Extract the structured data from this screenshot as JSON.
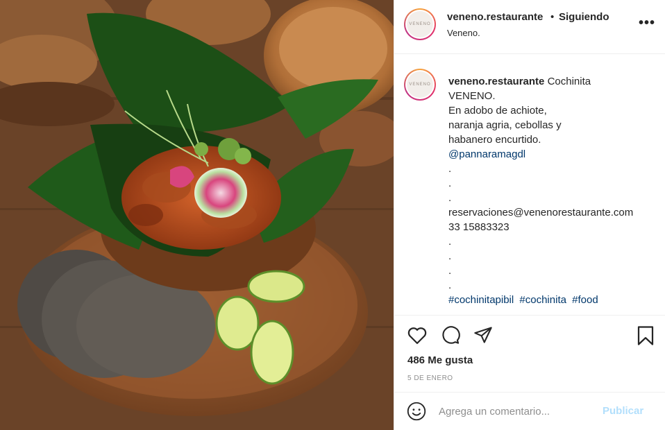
{
  "post": {
    "username": "veneno.restaurante",
    "separator": "•",
    "follow_status": "Siguiendo",
    "location": "Veneno.",
    "more_label": "•••",
    "avatar_text": "VENENO"
  },
  "caption": {
    "username": "veneno.restaurante",
    "lines": [
      "Cochinita",
      "VENENO.",
      "En adobo de achiote,",
      "naranja agria, cebollas y",
      "habanero encurtido.",
      "@pannaramagdl",
      ".",
      ".",
      ".",
      "reservaciones@venenorestaurante.com",
      "33 15883323",
      ".",
      ".",
      ".",
      "."
    ],
    "hashtags": [
      "#cochinitapibil",
      "#cochinita",
      "#food"
    ]
  },
  "actions": {
    "likes": "486 Me gusta",
    "date": "5 DE ENERO"
  },
  "comment": {
    "placeholder": "Agrega un comentario...",
    "publish_label": "Publicar"
  },
  "icons": {
    "like": "heart-icon",
    "comment": "comment-bubble-icon",
    "share": "paper-plane-icon",
    "save": "bookmark-icon",
    "emoji": "smiley-icon"
  }
}
